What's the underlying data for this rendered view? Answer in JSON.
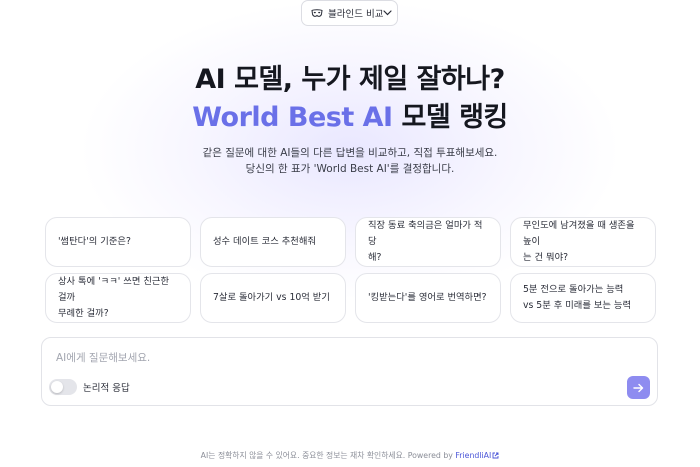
{
  "mode_select": {
    "label": "블라인드 비교",
    "icon": "mask-icon"
  },
  "hero": {
    "title_line1": "AI 모델, 누가 제일 잘하나?",
    "title_line2_accent": "World Best AI",
    "title_line2_rest": " 모델 랭킹",
    "desc_line1": "같은 질문에 대한 AI들의 다른 답변을 비교하고, 직접 투표해보세요.",
    "desc_line2": "당신의 한 표가 'World Best AI'를 결정합니다."
  },
  "accent_color": "#6a70e8",
  "suggestions": [
    {
      "line1": "'썸탄다'의 기준은?",
      "line2": ""
    },
    {
      "line1": "성수 데이트 코스 추천해줘",
      "line2": ""
    },
    {
      "line1": "직장 동료 축의금은 얼마가 적당",
      "line2": "해?"
    },
    {
      "line1": "무인도에 남겨졌을 때 생존을 높이",
      "line2": "는 건 뭐야?"
    },
    {
      "line1": "상사 톡에 'ㅋㅋ' 쓰면 친근한 걸까",
      "line2": "무례한 걸까?"
    },
    {
      "line1": "7살로 돌아가기 vs 10억 받기",
      "line2": ""
    },
    {
      "line1": "'킹받는다'를 영어로 번역하면?",
      "line2": ""
    },
    {
      "line1": "5분 전으로 돌아가는 능력",
      "line2": "vs 5분 후 미래를 보는 능력"
    }
  ],
  "chat": {
    "placeholder": "AI에게 질문해보세요.",
    "value": "",
    "toggle_label": "논리적 응답",
    "toggle_on": false,
    "send_color": "#8e8cf0"
  },
  "footer": {
    "text": "AI는 정확하지 않을 수 있어요. 중요한 정보는 재차 확인하세요. Powered by ",
    "brand": "FriendliAI"
  }
}
